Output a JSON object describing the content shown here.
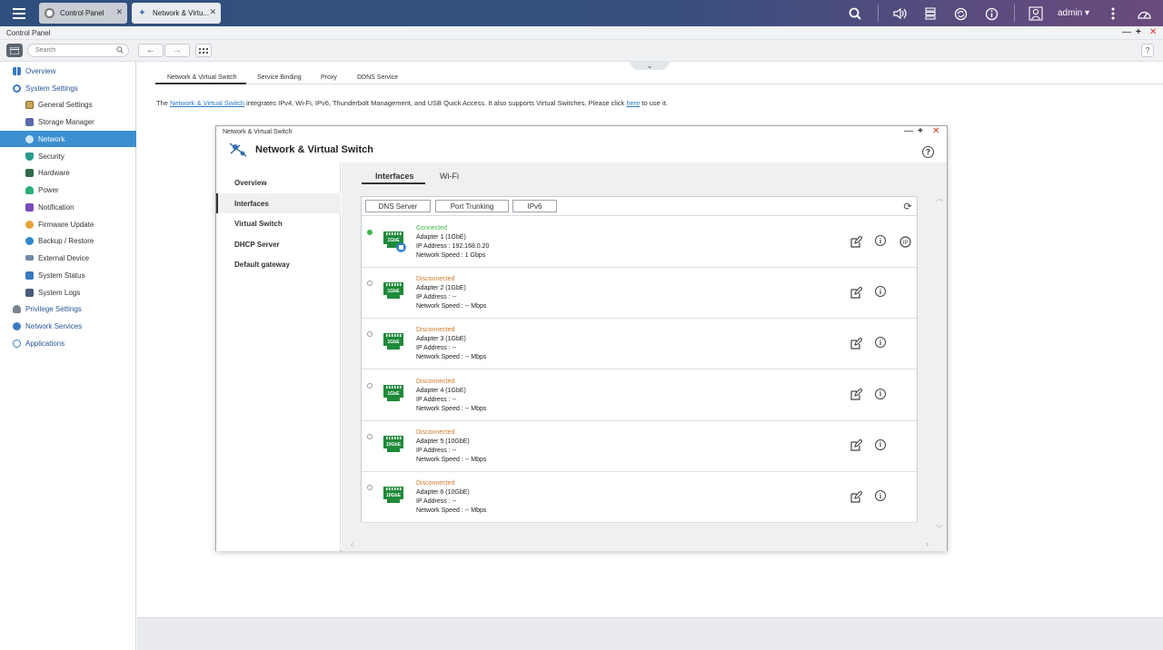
{
  "taskbar": {
    "tabs": [
      {
        "label": "Control Panel"
      },
      {
        "label": "Network & Virtu..."
      }
    ],
    "user": "admin"
  },
  "window": {
    "title": "Control Panel"
  },
  "toolbar": {
    "search_placeholder": "Search",
    "help": "?"
  },
  "sidebar": {
    "items": [
      {
        "label": "Overview"
      },
      {
        "label": "System Settings"
      },
      {
        "label": "General Settings"
      },
      {
        "label": "Storage Manager"
      },
      {
        "label": "Network"
      },
      {
        "label": "Security"
      },
      {
        "label": "Hardware"
      },
      {
        "label": "Power"
      },
      {
        "label": "Notification"
      },
      {
        "label": "Firmware Update"
      },
      {
        "label": "Backup / Restore"
      },
      {
        "label": "External Device"
      },
      {
        "label": "System Status"
      },
      {
        "label": "System Logs"
      },
      {
        "label": "Privilege Settings"
      },
      {
        "label": "Network Services"
      },
      {
        "label": "Applications"
      }
    ]
  },
  "main": {
    "tabs": [
      {
        "label": "Network & Virtual Switch"
      },
      {
        "label": "Service Binding"
      },
      {
        "label": "Proxy"
      },
      {
        "label": "DDNS Service"
      }
    ],
    "intro": {
      "prefix": "The ",
      "link": "Network & Virtual Switch",
      "middle": " integrates IPv4, Wi-Fi, IPv6, Thunderbolt Management, and USB Quick Access. It also supports Virtual Switches. Please click ",
      "here": "here",
      "suffix": " to use it."
    }
  },
  "nvs": {
    "window_label": "Network & Virtual Switch",
    "title": "Network & Virtual Switch",
    "help": "?",
    "nav": [
      {
        "label": "Overview"
      },
      {
        "label": "Interfaces"
      },
      {
        "label": "Virtual Switch"
      },
      {
        "label": "DHCP Server"
      },
      {
        "label": "Default gateway"
      }
    ],
    "tabs": [
      {
        "label": "Interfaces"
      },
      {
        "label": "Wi-Fi"
      }
    ],
    "buttons": [
      {
        "label": "DNS Server"
      },
      {
        "label": "Port Trunking"
      },
      {
        "label": "IPv6"
      }
    ],
    "adapters": [
      {
        "status": "Connected",
        "name": "Adapter 1 (1GbE)",
        "ip": "IP Address : 192.168.0.20",
        "speed": "Network Speed : 1 Gbps",
        "port_label": "1GbE"
      },
      {
        "status": "Disconnected",
        "name": "Adapter 2 (1GbE)",
        "ip": "IP Address : --",
        "speed": "Network Speed : -- Mbps",
        "port_label": "1GbE"
      },
      {
        "status": "Disconnected",
        "name": "Adapter 3 (1GbE)",
        "ip": "IP Address : --",
        "speed": "Network Speed : -- Mbps",
        "port_label": "1GbE"
      },
      {
        "status": "Disconnected",
        "name": "Adapter 4 (1GbE)",
        "ip": "IP Address : --",
        "speed": "Network Speed : -- Mbps",
        "port_label": "1GbE"
      },
      {
        "status": "Disconnected",
        "name": "Adapter 5 (10GbE)",
        "ip": "IP Address : --",
        "speed": "Network Speed : -- Mbps",
        "port_label": "10GbE"
      },
      {
        "status": "Disconnected",
        "name": "Adapter 6 (10GbE)",
        "ip": "IP Address : --",
        "speed": "Network Speed : -- Mbps",
        "port_label": "10GbE"
      }
    ]
  },
  "colors": {
    "accent": "#3b8fd0",
    "connected": "#3db54a",
    "disconnected": "#d07a2a",
    "port_green": "#1f8a3a"
  }
}
